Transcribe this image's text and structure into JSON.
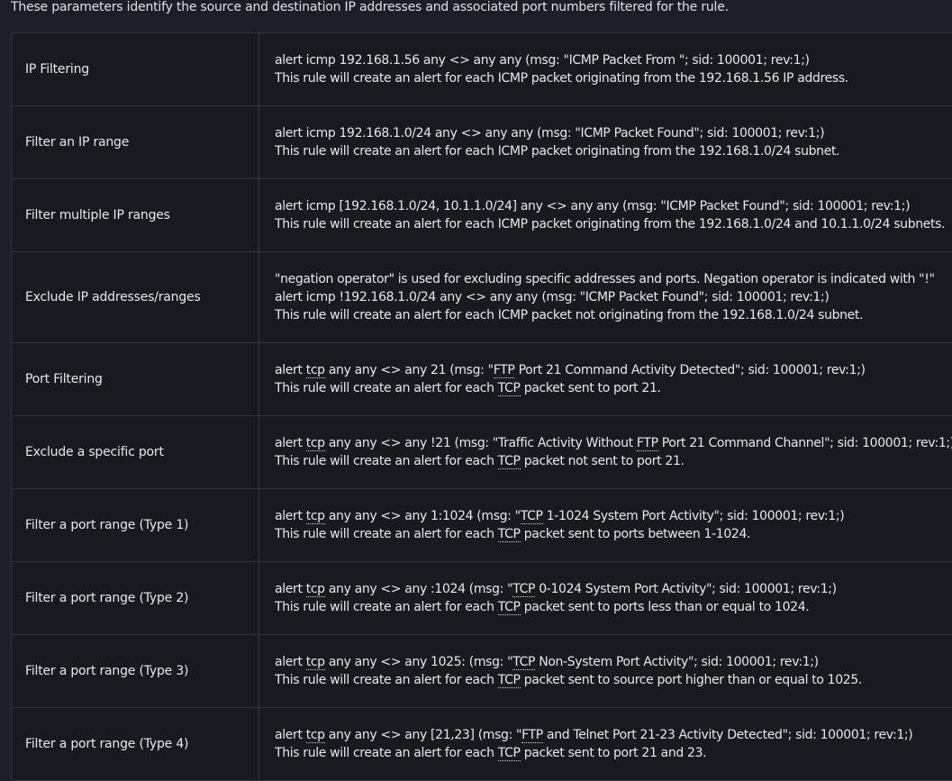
{
  "intro": "These parameters identify the source and destination IP addresses and associated port numbers filtered for the rule.",
  "rows": [
    {
      "label": "IP Filtering",
      "lines": [
        "alert icmp 192.168.1.56 any <> any any  (msg: \"ICMP Packet From \"; sid: 100001; rev:1;)",
        "This rule will create an alert for each ICMP packet originating from the 192.168.1.56 IP address."
      ]
    },
    {
      "label": "Filter an IP range",
      "lines": [
        "alert icmp 192.168.1.0/24 any <> any any  (msg: \"ICMP Packet Found\"; sid: 100001; rev:1;)",
        "This rule will create an alert for each ICMP packet originating from the 192.168.1.0/24 subnet."
      ]
    },
    {
      "label": "Filter multiple IP ranges",
      "lines": [
        "alert icmp [192.168.1.0/24, 10.1.1.0/24] any <> any any  (msg: \"ICMP Packet Found\"; sid: 100001; rev:1;)",
        "This rule will create an alert for each ICMP packet originating from the 192.168.1.0/24 and 10.1.1.0/24 subnets."
      ]
    },
    {
      "label": "Exclude IP addresses/ranges",
      "lines": [
        "\"negation operator\" is used for excluding specific addresses and ports. Negation operator is indicated with \"!\"",
        "alert icmp !192.168.1.0/24 any <> any any  (msg: \"ICMP Packet Found\"; sid: 100001; rev:1;)",
        "This rule will create an alert for each ICMP packet not originating from the 192.168.1.0/24 subnet."
      ]
    },
    {
      "label": "Port Filtering",
      "lines": [
        "alert tcp any any <> any 21  (msg: \"FTP Port 21 Command Activity Detected\"; sid: 100001; rev:1;)",
        "This rule will create an alert for each TCP packet sent to port 21."
      ]
    },
    {
      "label": "Exclude a specific port",
      "lines": [
        "alert tcp any any <> any !21  (msg: \"Traffic Activity Without FTP Port 21 Command Channel\"; sid: 100001; rev:1;)",
        "This rule will create an alert for each TCP packet not sent to port 21."
      ]
    },
    {
      "label": "Filter a port range (Type 1)",
      "lines": [
        "alert tcp any any <> any 1:1024   (msg: \"TCP 1-1024 System Port Activity\"; sid: 100001; rev:1;)",
        "This rule will create an alert for each TCP packet sent to ports between 1-1024."
      ]
    },
    {
      "label": "Filter a port range (Type 2)",
      "lines": [
        "alert tcp any any <> any :1024   (msg: \"TCP 0-1024 System Port Activity\"; sid: 100001; rev:1;)",
        "This rule will create an alert for each TCP packet sent to ports less than or equal to 1024."
      ]
    },
    {
      "label": "Filter a port range (Type 3)",
      "lines": [
        "alert tcp any any <> any 1025: (msg: \"TCP Non-System Port Activity\"; sid: 100001; rev:1;)",
        "This rule will create an alert for each TCP packet sent to source port higher than or equal to 1025."
      ]
    },
    {
      "label": "Filter a port range (Type 4)",
      "lines": [
        "alert tcp any any <> any [21,23] (msg: \"FTP and Telnet Port 21-23 Activity Detected\"; sid: 100001; rev:1;)",
        "This rule will create an alert for each TCP packet sent to port 21 and 23."
      ]
    }
  ],
  "abbreviations": [
    "tcp",
    "TCP",
    "FTP"
  ],
  "colors": {
    "background": "#1b1e26",
    "table_background": "#171a21",
    "border": "#30343d",
    "text": "#e6e8ec"
  }
}
